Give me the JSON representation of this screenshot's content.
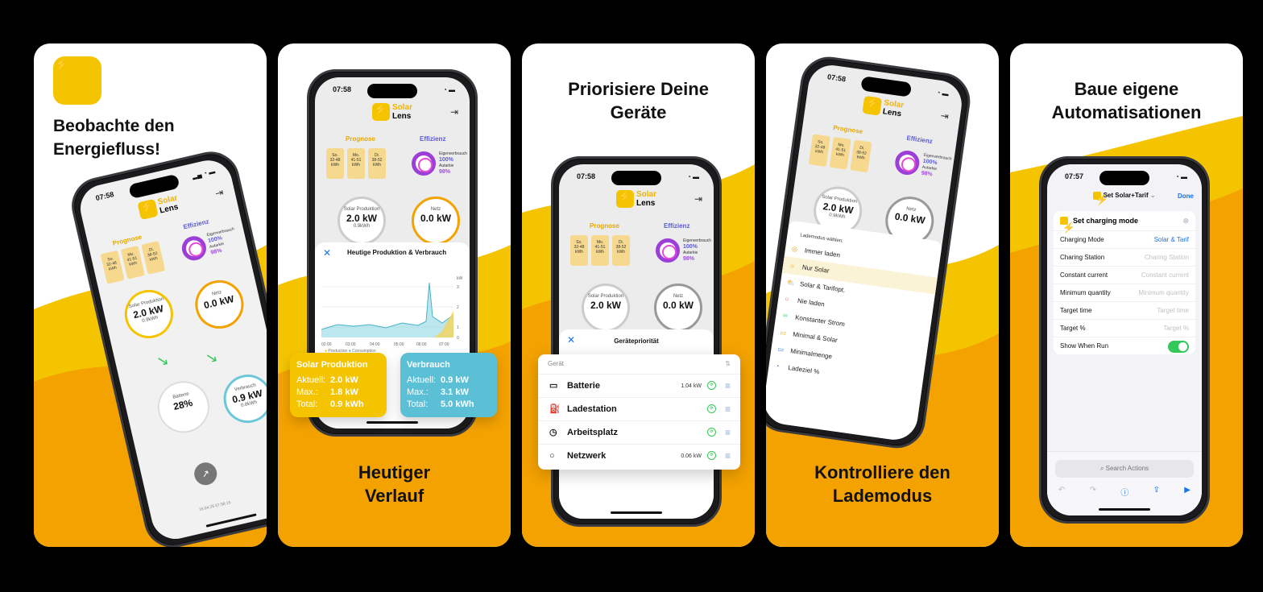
{
  "colors": {
    "brand_yellow": "#f5c400",
    "orange": "#f3a200",
    "green": "#34c759",
    "blue": "#1a73e8",
    "purple": "#7a3fd8"
  },
  "panel1": {
    "headline": [
      "Beobachte den",
      "Energiefluss!"
    ],
    "phone": {
      "time": "07:58",
      "brand1": "Solar",
      "brand2": "Lens",
      "prognose": "Prognose",
      "effizienz": "Effizienz",
      "cards": [
        {
          "day": "So.",
          "range": "32-48",
          "unit": "kWh"
        },
        {
          "day": "Mo.",
          "range": "41-51",
          "unit": "kWh"
        },
        {
          "day": "Di.",
          "range": "38-52",
          "unit": "kWh"
        }
      ],
      "eigenverbrauch_label": "Eigenverbrauch",
      "eigenverbrauch": "100%",
      "autarkie_label": "Autarkie",
      "autarkie": "98%",
      "solar_label": "Solar Produktion",
      "solar_value": "2.0 kW",
      "solar_sub": "0.9kWh",
      "netz_label": "Netz",
      "netz_value": "0.0 kW",
      "batterie_label": "Batterie",
      "batterie_value": "28%",
      "verbrauch_label": "Verbrauch",
      "verbrauch_value": "0.9 kW",
      "verbrauch_sub": "0.8kWh",
      "timestamp": "16.04.25 07:58:15"
    }
  },
  "panel2": {
    "headline": [
      "Heutiger",
      "Verlauf"
    ],
    "phone": {
      "time": "07:58",
      "brand1": "Solar",
      "brand2": "Lens",
      "prognose": "Prognose",
      "effizienz": "Effizienz",
      "cards": [
        {
          "day": "So.",
          "range": "32-48",
          "unit": "kWh"
        },
        {
          "day": "Mo.",
          "range": "41-51",
          "unit": "kWh"
        },
        {
          "day": "Di.",
          "range": "38-52",
          "unit": "kWh"
        }
      ],
      "eigenverbrauch_label": "Eigenverbrauch",
      "eigenverbrauch": "100%",
      "autarkie_label": "Autarkie",
      "autarkie": "98%",
      "solar_label": "Solar Produktion",
      "solar_value": "2.0 kW",
      "solar_sub": "0.9kWh",
      "netz_label": "Netz",
      "netz_value": "0.0 kW",
      "sheet_title": "Heutige Produktion & Verbrauch",
      "axis_unit": "kW",
      "x_ticks": [
        "02:00",
        "03:00",
        "04:00",
        "05:00",
        "06:00",
        "07:00"
      ],
      "y_ticks": [
        "3",
        "2",
        "1",
        "0"
      ],
      "legend_production": "Production",
      "legend_consumption": "Consumption"
    },
    "solar_card": {
      "title": "Solar Produktion",
      "aktuell_label": "Aktuell:",
      "aktuell": "2.0 kW",
      "max_label": "Max.:",
      "max": "1.8 kW",
      "total_label": "Total:",
      "total": "0.9 kWh"
    },
    "verbrauch_card": {
      "title": "Verbrauch",
      "aktuell_label": "Aktuell:",
      "aktuell": "0.9 kW",
      "max_label": "Max.:",
      "max": "3.1 kW",
      "total_label": "Total:",
      "total": "5.0 kWh"
    }
  },
  "panel3": {
    "headline": [
      "Priorisiere Deine",
      "Geräte"
    ],
    "phone": {
      "time": "07:58",
      "brand1": "Solar",
      "brand2": "Lens",
      "prognose": "Prognose",
      "effizienz": "Effizienz",
      "cards": [
        {
          "day": "So.",
          "range": "32-48",
          "unit": "kWh"
        },
        {
          "day": "Mo.",
          "range": "41-51",
          "unit": "kWh"
        },
        {
          "day": "Di.",
          "range": "38-52",
          "unit": "kWh"
        }
      ],
      "eigenverbrauch_label": "Eigenverbrauch",
      "eigenverbrauch": "100%",
      "autarkie_label": "Autarkie",
      "autarkie": "98%",
      "solar_label": "Solar Produktion",
      "solar_value": "2.0 kW",
      "netz_label": "Netz",
      "netz_value": "0.0 kW",
      "sheet_title": "Gerätepriorität"
    },
    "list_header": "Gerät",
    "devices": [
      {
        "name": "Batterie",
        "kw": "1.04 kW",
        "icon": "battery-icon",
        "glyph": "▭"
      },
      {
        "name": "Ladestation",
        "kw": "",
        "icon": "charger-icon",
        "glyph": "⛽"
      },
      {
        "name": "Arbeitsplatz",
        "kw": "",
        "icon": "clock-icon",
        "glyph": "◷"
      },
      {
        "name": "Netzwerk",
        "kw": "0.06 kW",
        "icon": "circle-icon",
        "glyph": "○"
      }
    ]
  },
  "panel4": {
    "headline": [
      "Kontrolliere den",
      "Lademodus"
    ],
    "phone": {
      "time": "07:58",
      "brand1": "Solar",
      "brand2": "Lens",
      "prognose": "Prognose",
      "effizienz": "Effizienz",
      "cards": [
        {
          "day": "So.",
          "range": "32-48",
          "unit": "kWh"
        },
        {
          "day": "Mo.",
          "range": "41-51",
          "unit": "kWh"
        },
        {
          "day": "Di.",
          "range": "38-52",
          "unit": "kWh"
        }
      ],
      "eigenverbrauch_label": "Eigenverbrauch",
      "eigenverbrauch": "100%",
      "autarkie_label": "Autarkie",
      "autarkie": "98%",
      "solar_label": "Solar Produktion",
      "solar_value": "2.0 kW",
      "solar_sub": "0.9kWh",
      "netz_label": "Netz",
      "netz_value": "0.0 kW",
      "menu_title": "Lademodus wählen:",
      "modes": [
        {
          "label": "Immer laden",
          "glyph": "◎"
        },
        {
          "label": "Nur Solar",
          "glyph": "☼"
        },
        {
          "label": "Solar & Tarifopt.",
          "glyph": "⛅"
        },
        {
          "label": "Nie laden",
          "glyph": "○"
        },
        {
          "label": "Konstanter Strom",
          "glyph": "♾"
        },
        {
          "label": "Minimal & Solar",
          "glyph": "▭"
        },
        {
          "label": "Minimalmenge",
          "glyph": "▭"
        },
        {
          "label": "Ladeziel %",
          "glyph": "◔"
        }
      ]
    }
  },
  "panel5": {
    "headline": [
      "Baue eigene",
      "Automatisationen"
    ],
    "phone": {
      "time": "07:57",
      "title": "Set Solar+Tarif",
      "done": "Done",
      "action_title": "Set charging mode",
      "rows": [
        {
          "label": "Charging Mode",
          "value": "Solar & Tarif",
          "active": true
        },
        {
          "label": "Charing Station",
          "value": "Charing Station",
          "active": false
        },
        {
          "label": "Constant current",
          "value": "Constant current",
          "active": false
        },
        {
          "label": "Minimum quantity",
          "value": "Minimum quantity",
          "active": false
        },
        {
          "label": "Target time",
          "value": "Target time",
          "active": false
        },
        {
          "label": "Target %",
          "value": "Target %",
          "active": false
        }
      ],
      "toggle_label": "Show When Run",
      "search_placeholder": "Search Actions"
    }
  }
}
